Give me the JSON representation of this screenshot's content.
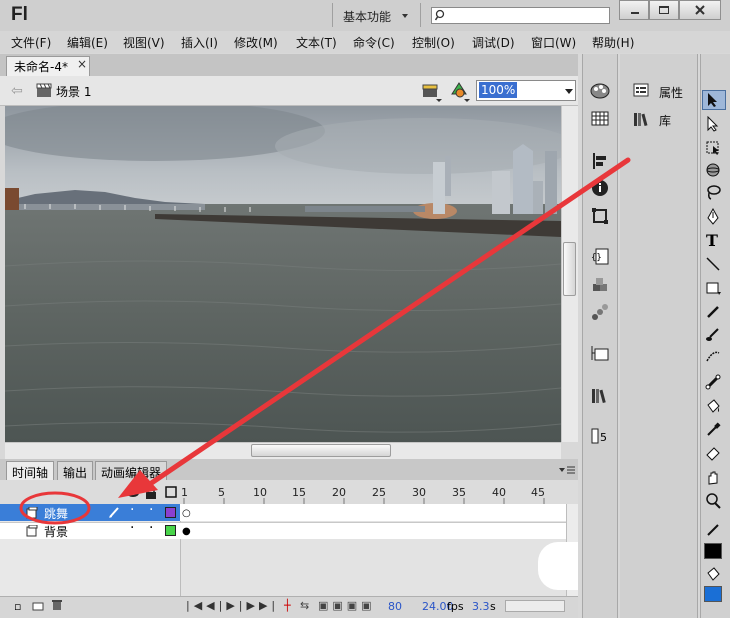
{
  "app": {
    "logo": "Fl",
    "workspace": "基本功能"
  },
  "menu": [
    "文件(F)",
    "编辑(E)",
    "视图(V)",
    "插入(I)",
    "修改(M)",
    "文本(T)",
    "命令(C)",
    "控制(O)",
    "调试(D)",
    "窗口(W)",
    "帮助(H)"
  ],
  "document": {
    "tab_label": "未命名-4*",
    "close_glyph": "×",
    "scene_label": "场景 1",
    "zoom": "100%"
  },
  "timeline": {
    "tabs": [
      "时间轴",
      "输出",
      "动画编辑器"
    ],
    "frame_numbers": [
      "1",
      "5",
      "10",
      "15",
      "20",
      "25",
      "30",
      "35",
      "40",
      "45"
    ],
    "layers": [
      {
        "name": "跳舞",
        "selected": true,
        "color": "#8b3fd0"
      },
      {
        "name": "背景",
        "selected": false,
        "color": "#49d44a"
      }
    ],
    "status": {
      "current_frame": "80",
      "fps": "24.00",
      "fps_unit": "fps",
      "elapsed": "3.3",
      "elapsed_unit": "s"
    }
  },
  "panels": {
    "properties_label": "属性",
    "library_label": "库"
  },
  "colors": {
    "selection": "#3a7ed8",
    "annotation_red": "#e8373a",
    "fill_swatch": "#1a6fd6",
    "stroke_swatch": "#000000"
  }
}
